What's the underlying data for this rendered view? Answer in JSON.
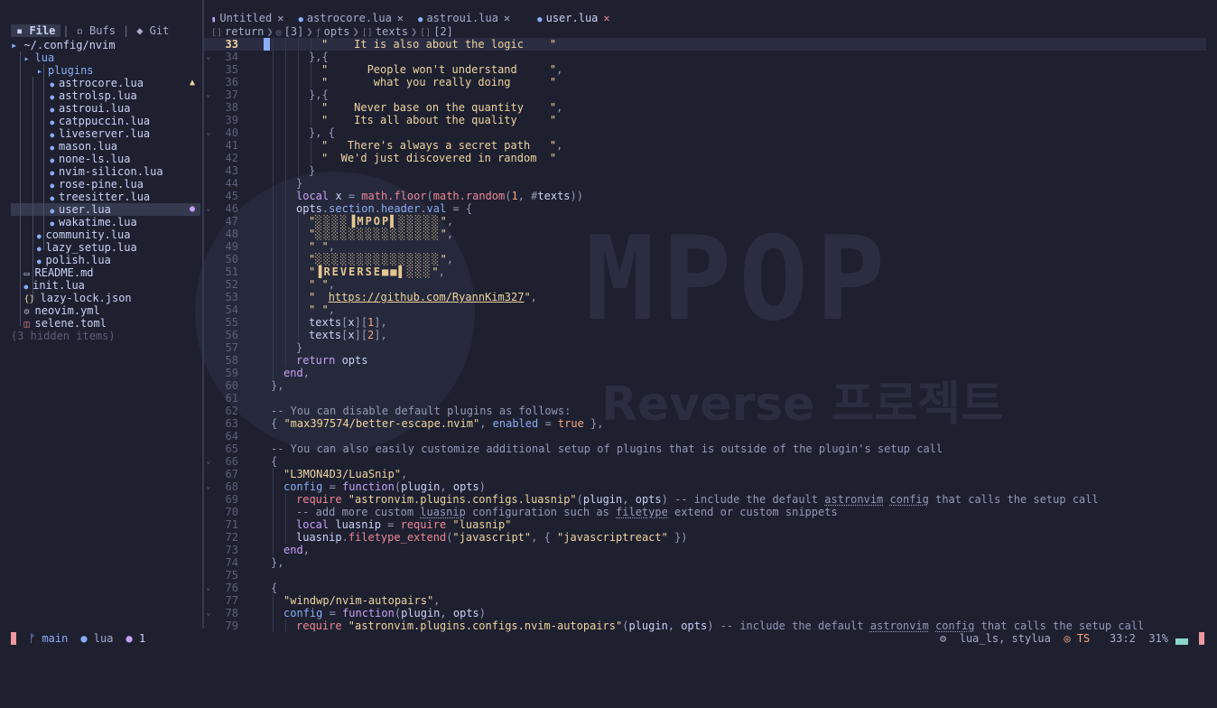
{
  "explorer": {
    "tabs": [
      {
        "icon": "file-icon",
        "label": "File"
      },
      {
        "icon": "buffers-icon",
        "label": "Bufs"
      },
      {
        "icon": "git-icon",
        "label": "Git"
      }
    ],
    "root": "~/.config/nvim",
    "items": [
      {
        "label": "lua",
        "kind": "dir",
        "depth": 1
      },
      {
        "label": "plugins",
        "kind": "dir",
        "depth": 2
      },
      {
        "label": "astrocore.lua",
        "kind": "lua",
        "depth": 3,
        "badge": "warning"
      },
      {
        "label": "astrolsp.lua",
        "kind": "lua",
        "depth": 3
      },
      {
        "label": "astroui.lua",
        "kind": "lua",
        "depth": 3
      },
      {
        "label": "catppuccin.lua",
        "kind": "lua",
        "depth": 3
      },
      {
        "label": "liveserver.lua",
        "kind": "lua",
        "depth": 3
      },
      {
        "label": "mason.lua",
        "kind": "lua",
        "depth": 3
      },
      {
        "label": "none-ls.lua",
        "kind": "lua",
        "depth": 3
      },
      {
        "label": "nvim-silicon.lua",
        "kind": "lua",
        "depth": 3
      },
      {
        "label": "rose-pine.lua",
        "kind": "lua",
        "depth": 3
      },
      {
        "label": "treesitter.lua",
        "kind": "lua",
        "depth": 3
      },
      {
        "label": "user.lua",
        "kind": "lua",
        "depth": 3,
        "selected": true,
        "badge": "hint"
      },
      {
        "label": "wakatime.lua",
        "kind": "lua",
        "depth": 3
      },
      {
        "label": "community.lua",
        "kind": "lua",
        "depth": 2
      },
      {
        "label": "lazy_setup.lua",
        "kind": "lua",
        "depth": 2
      },
      {
        "label": "polish.lua",
        "kind": "lua",
        "depth": 2
      },
      {
        "label": "README.md",
        "kind": "md",
        "depth": 1
      },
      {
        "label": "init.lua",
        "kind": "lua",
        "depth": 1
      },
      {
        "label": "lazy-lock.json",
        "kind": "json",
        "depth": 1
      },
      {
        "label": "neovim.yml",
        "kind": "yml",
        "depth": 1
      },
      {
        "label": "selene.toml",
        "kind": "toml",
        "depth": 1
      }
    ],
    "hidden_items": "(3 hidden items)"
  },
  "buffers": [
    {
      "label": "Untitled",
      "icon": "new-file-icon",
      "active": false
    },
    {
      "label": "astrocore.lua",
      "icon": "lua-icon",
      "active": false
    },
    {
      "label": "astroui.lua",
      "icon": "lua-icon",
      "active": false
    },
    {
      "label": "user.lua",
      "icon": "lua-icon",
      "active": true
    }
  ],
  "winbar": [
    {
      "sym": "[]",
      "label": "return"
    },
    {
      "sym": "◎",
      "label": "[3]"
    },
    {
      "sym": "ƒ",
      "label": "opts"
    },
    {
      "sym": "[]",
      "label": "texts"
    },
    {
      "sym": "[]",
      "label": "[2]"
    }
  ],
  "watermark": {
    "big": "MPOP",
    "small": "Reverse 프로젝트"
  },
  "lines": [
    {
      "n": "33",
      "cur": true,
      "ind": 4,
      "t": [
        [
          "s",
          "\"    It is also about the logic    \""
        ]
      ]
    },
    {
      "n": "34",
      "fold": true,
      "ind": 3,
      "t": [
        [
          "p",
          "},{"
        ]
      ]
    },
    {
      "n": "35",
      "ind": 4,
      "t": [
        [
          "s",
          "\"      People won't understand     \""
        ],
        [
          "p",
          ","
        ]
      ]
    },
    {
      "n": "36",
      "ind": 4,
      "t": [
        [
          "s",
          "\"       what you really doing      \""
        ]
      ]
    },
    {
      "n": "37",
      "fold": true,
      "ind": 3,
      "t": [
        [
          "p",
          "},{"
        ]
      ]
    },
    {
      "n": "38",
      "ind": 4,
      "t": [
        [
          "s",
          "\"    Never base on the quantity    \""
        ],
        [
          "p",
          ","
        ]
      ]
    },
    {
      "n": "39",
      "ind": 4,
      "t": [
        [
          "s",
          "\"    Its all about the quality     \""
        ]
      ]
    },
    {
      "n": "40",
      "fold": true,
      "ind": 3,
      "t": [
        [
          "p",
          "}, {"
        ]
      ]
    },
    {
      "n": "41",
      "ind": 4,
      "t": [
        [
          "s",
          "\"   There's always a secret path   \""
        ],
        [
          "p",
          ","
        ]
      ]
    },
    {
      "n": "42",
      "ind": 4,
      "t": [
        [
          "s",
          "\"  We'd just discovered in random  \""
        ]
      ]
    },
    {
      "n": "43",
      "ind": 3,
      "t": [
        [
          "p",
          "}"
        ]
      ]
    },
    {
      "n": "44",
      "ind": 2,
      "t": [
        [
          "p",
          "}"
        ]
      ]
    },
    {
      "n": "45",
      "ind": 2,
      "t": [
        [
          "k",
          "local "
        ],
        [
          "v",
          "x "
        ],
        [
          "p",
          "= "
        ],
        [
          "f",
          "math.floor"
        ],
        [
          "p",
          "("
        ],
        [
          "f",
          "math.random"
        ],
        [
          "p",
          "("
        ],
        [
          "n",
          "1"
        ],
        [
          "p",
          ", #"
        ],
        [
          "v",
          "texts"
        ],
        [
          "p",
          "))"
        ]
      ]
    },
    {
      "n": "46",
      "fold": true,
      "ind": 2,
      "t": [
        [
          "v",
          "opts"
        ],
        [
          "p",
          "."
        ],
        [
          "d",
          "section"
        ],
        [
          "p",
          "."
        ],
        [
          "d",
          "header"
        ],
        [
          "p",
          "."
        ],
        [
          "d",
          "val"
        ],
        [
          "p",
          " = {"
        ]
      ]
    },
    {
      "n": "47",
      "ind": 3,
      "t": [
        [
          "s",
          "\""
        ],
        [
          "a",
          "░░░░▐MPOP▌░░░░░"
        ],
        [
          "s",
          "\""
        ],
        [
          "p",
          ","
        ]
      ]
    },
    {
      "n": "48",
      "ind": 3,
      "t": [
        [
          "s",
          "\""
        ],
        [
          "a",
          "░░░░░░░░░░░░░░░"
        ],
        [
          "s",
          "\""
        ],
        [
          "p",
          ","
        ]
      ]
    },
    {
      "n": "49",
      "ind": 3,
      "t": [
        [
          "s",
          "\" \""
        ],
        [
          "p",
          ","
        ]
      ]
    },
    {
      "n": "50",
      "ind": 3,
      "t": [
        [
          "s",
          "\""
        ],
        [
          "a",
          "░░░░░░░░░░░░░░░"
        ],
        [
          "s",
          "\""
        ],
        [
          "p",
          ","
        ]
      ]
    },
    {
      "n": "51",
      "ind": 3,
      "t": [
        [
          "s",
          "\""
        ],
        [
          "a",
          "▐REVERSE■■▌░░░"
        ],
        [
          "s",
          "\""
        ],
        [
          "p",
          ","
        ]
      ]
    },
    {
      "n": "52",
      "ind": 3,
      "t": [
        [
          "s",
          "\" \""
        ],
        [
          "p",
          ","
        ]
      ]
    },
    {
      "n": "53",
      "ind": 3,
      "t": [
        [
          "s",
          "\"  "
        ],
        [
          "u",
          "https://github.com/RyannKim327"
        ],
        [
          "s",
          "\""
        ],
        [
          "p",
          ","
        ]
      ]
    },
    {
      "n": "54",
      "ind": 3,
      "t": [
        [
          "s",
          "\" \""
        ],
        [
          "p",
          ","
        ]
      ]
    },
    {
      "n": "55",
      "ind": 3,
      "t": [
        [
          "v",
          "texts"
        ],
        [
          "p",
          "["
        ],
        [
          "v",
          "x"
        ],
        [
          "p",
          "]["
        ],
        [
          "n",
          "1"
        ],
        [
          "p",
          "],"
        ]
      ]
    },
    {
      "n": "56",
      "ind": 3,
      "t": [
        [
          "v",
          "texts"
        ],
        [
          "p",
          "["
        ],
        [
          "v",
          "x"
        ],
        [
          "p",
          "]["
        ],
        [
          "n",
          "2"
        ],
        [
          "p",
          "],"
        ]
      ]
    },
    {
      "n": "57",
      "ind": 2,
      "t": [
        [
          "p",
          "}"
        ]
      ]
    },
    {
      "n": "58",
      "ind": 2,
      "t": [
        [
          "k",
          "return "
        ],
        [
          "v",
          "opts"
        ]
      ]
    },
    {
      "n": "59",
      "ind": 1,
      "t": [
        [
          "k",
          "end"
        ],
        [
          "p",
          ","
        ]
      ]
    },
    {
      "n": "60",
      "ind": 0,
      "t": [
        [
          "p",
          "},"
        ]
      ]
    },
    {
      "n": "61",
      "ind": 0,
      "t": []
    },
    {
      "n": "62",
      "ind": 0,
      "t": [
        [
          "c",
          "-- You can disable default plugins as follows:"
        ]
      ]
    },
    {
      "n": "63",
      "ind": 0,
      "t": [
        [
          "p",
          "{ "
        ],
        [
          "s",
          "\"max397574/better-escape.nvim\""
        ],
        [
          "p",
          ", "
        ],
        [
          "d",
          "enabled "
        ],
        [
          "p",
          "= "
        ],
        [
          "b",
          "true"
        ],
        [
          "p",
          " },"
        ]
      ]
    },
    {
      "n": "64",
      "ind": 0,
      "t": []
    },
    {
      "n": "65",
      "ind": 0,
      "t": [
        [
          "c",
          "-- You can also easily customize additional setup of plugins that is outside of the plugin's setup call"
        ]
      ]
    },
    {
      "n": "66",
      "fold": true,
      "ind": 0,
      "t": [
        [
          "p",
          "{"
        ]
      ]
    },
    {
      "n": "67",
      "ind": 1,
      "t": [
        [
          "s",
          "\"L3MON4D3/LuaSnip\""
        ],
        [
          "p",
          ","
        ]
      ]
    },
    {
      "n": "68",
      "fold": true,
      "ind": 1,
      "t": [
        [
          "d",
          "config "
        ],
        [
          "p",
          "= "
        ],
        [
          "k",
          "function"
        ],
        [
          "p",
          "("
        ],
        [
          "v",
          "plugin"
        ],
        [
          "p",
          ", "
        ],
        [
          "v",
          "opts"
        ],
        [
          "p",
          ")"
        ]
      ]
    },
    {
      "n": "69",
      "ind": 2,
      "t": [
        [
          "f",
          "require "
        ],
        [
          "s",
          "\"astronvim.plugins.configs.luasnip\""
        ],
        [
          "p",
          "("
        ],
        [
          "v",
          "plugin"
        ],
        [
          "p",
          ", "
        ],
        [
          "v",
          "opts"
        ],
        [
          "p",
          ") "
        ],
        [
          "c",
          "-- include the default "
        ],
        [
          "cu",
          "astronvim"
        ],
        [
          "c",
          " "
        ],
        [
          "cu",
          "config"
        ],
        [
          "c",
          " that calls the setup call"
        ]
      ]
    },
    {
      "n": "70",
      "ind": 2,
      "t": [
        [
          "c",
          "-- add more custom "
        ],
        [
          "cu",
          "luasnip"
        ],
        [
          "c",
          " configuration such as "
        ],
        [
          "cu",
          "filetype"
        ],
        [
          "c",
          " extend or custom snippets"
        ]
      ]
    },
    {
      "n": "71",
      "ind": 2,
      "t": [
        [
          "k",
          "local "
        ],
        [
          "v",
          "luasnip "
        ],
        [
          "p",
          "= "
        ],
        [
          "f",
          "require "
        ],
        [
          "s",
          "\"luasnip\""
        ]
      ]
    },
    {
      "n": "72",
      "ind": 2,
      "t": [
        [
          "v",
          "luasnip"
        ],
        [
          "p",
          "."
        ],
        [
          "f",
          "filetype_extend"
        ],
        [
          "p",
          "("
        ],
        [
          "s",
          "\"javascript\""
        ],
        [
          "p",
          ", { "
        ],
        [
          "s",
          "\"javascriptreact\""
        ],
        [
          "p",
          " })"
        ]
      ]
    },
    {
      "n": "73",
      "ind": 1,
      "t": [
        [
          "k",
          "end"
        ],
        [
          "p",
          ","
        ]
      ]
    },
    {
      "n": "74",
      "ind": 0,
      "t": [
        [
          "p",
          "},"
        ]
      ]
    },
    {
      "n": "75",
      "ind": 0,
      "t": []
    },
    {
      "n": "76",
      "fold": true,
      "ind": 0,
      "t": [
        [
          "p",
          "{"
        ]
      ]
    },
    {
      "n": "77",
      "ind": 1,
      "t": [
        [
          "s",
          "\"windwp/nvim-autopairs\""
        ],
        [
          "p",
          ","
        ]
      ]
    },
    {
      "n": "78",
      "fold": true,
      "ind": 1,
      "t": [
        [
          "d",
          "config "
        ],
        [
          "p",
          "= "
        ],
        [
          "k",
          "function"
        ],
        [
          "p",
          "("
        ],
        [
          "v",
          "plugin"
        ],
        [
          "p",
          ", "
        ],
        [
          "v",
          "opts"
        ],
        [
          "p",
          ")"
        ]
      ]
    },
    {
      "n": "79",
      "ind": 2,
      "t": [
        [
          "f",
          "require "
        ],
        [
          "s",
          "\"astronvim.plugins.configs.nvim-autopairs\""
        ],
        [
          "p",
          "("
        ],
        [
          "v",
          "plugin"
        ],
        [
          "p",
          ", "
        ],
        [
          "v",
          "opts"
        ],
        [
          "p",
          ") "
        ],
        [
          "c",
          "-- include the default "
        ],
        [
          "cu",
          "astronvim"
        ],
        [
          "c",
          " "
        ],
        [
          "cu",
          "config"
        ],
        [
          "c",
          " that calls the setup call"
        ]
      ]
    }
  ],
  "status": {
    "branch": "main",
    "filetype": "lua",
    "hints": "1",
    "lsp": "lua_ls, stylua",
    "treesitter": "TS",
    "position": "33:2",
    "percent": "31%"
  },
  "colors": {
    "accent": "#8aadf4",
    "mode": "#ee99a0",
    "warning": "#eed49f",
    "string": "#eed49f",
    "keyword": "#c6a0f6"
  }
}
